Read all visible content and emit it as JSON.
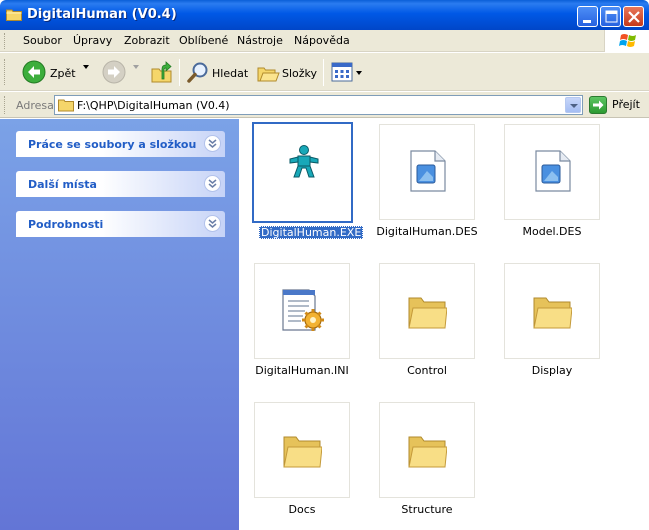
{
  "window": {
    "title": "DigitalHuman (V0.4)",
    "title_icon": "folder-icon",
    "controls": [
      "minimize-icon",
      "maximize-icon",
      "close-icon"
    ]
  },
  "menu": {
    "items": [
      "Soubor",
      "Úpravy",
      "Zobrazit",
      "Oblíbené",
      "Nástroje",
      "Nápověda"
    ]
  },
  "toolbar": {
    "back_label": "Zpět",
    "search_label": "Hledat",
    "folders_label": "Složky",
    "icons": [
      "back-arrow-icon",
      "forward-arrow-icon",
      "up-folder-icon",
      "search-icon",
      "folders-icon",
      "views-icon"
    ]
  },
  "address": {
    "label": "Adresa",
    "value": "F:\\QHP\\DigitalHuman (V0.4)",
    "go_label": "Přejít"
  },
  "tasks": {
    "panels": [
      "Práce se soubory a složkou",
      "Další místa",
      "Podrobnosti"
    ]
  },
  "files": [
    {
      "name": "DigitalHuman.EXE",
      "icon": "application-icon",
      "selected": true
    },
    {
      "name": "DigitalHuman.DES",
      "icon": "document-icon",
      "selected": false
    },
    {
      "name": "Model.DES",
      "icon": "document-icon",
      "selected": false
    },
    {
      "name": "DigitalHuman.INI",
      "icon": "settings-file-icon",
      "selected": false
    },
    {
      "name": "Control",
      "icon": "folder-icon",
      "selected": false
    },
    {
      "name": "Display",
      "icon": "folder-icon",
      "selected": false
    },
    {
      "name": "Docs",
      "icon": "folder-icon",
      "selected": false
    },
    {
      "name": "Structure",
      "icon": "folder-icon",
      "selected": false
    }
  ],
  "colors": {
    "titlebar": "#0054e3",
    "selection": "#316ac5",
    "taskpane_top": "#7ba2e7",
    "taskpane_bottom": "#6375d6",
    "task_title": "#215dc6"
  }
}
